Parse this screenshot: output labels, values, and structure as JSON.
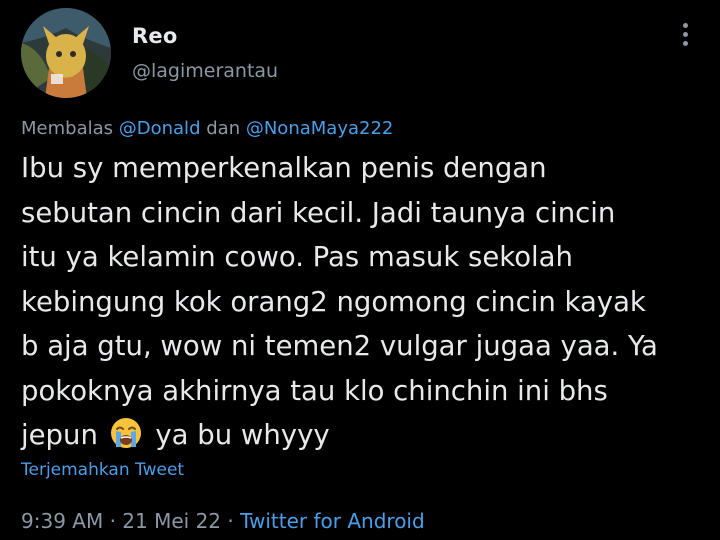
{
  "user": {
    "display_name": "Reo",
    "handle": "@lagimerantau",
    "avatar_icon": "avatar-image"
  },
  "menu": {
    "icon": "more-vertical-icon"
  },
  "reply": {
    "prefix": "Membalas",
    "mention_1": "@Donald",
    "conjunction": "dan",
    "mention_2": "@NonaMaya222"
  },
  "tweet": {
    "lines": [
      "Ibu sy memperkenalkan penis dengan",
      "sebutan cincin dari kecil. Jadi taunya cincin",
      "itu ya kelamin cowo. Pas masuk sekolah",
      "kebingung kok orang2 ngomong cincin kayak",
      "b aja gtu, wow ni temen2 vulgar jugaa yaa. Ya",
      "pokoknya akhirnya tau klo chinchin ini bhs"
    ],
    "last_line_before": "jepun",
    "emoji": "loudly-crying-face-icon",
    "last_line_after": "ya bu whyyy"
  },
  "translate_label": "Terjemahkan Tweet",
  "meta": {
    "time": "9:39 AM",
    "sep_1": "·",
    "date": "21 Mei 22",
    "sep_2": "·",
    "source": "Twitter for Android"
  },
  "colors": {
    "background": "#000000",
    "text": "#e7e9ea",
    "secondary": "#8b98a5",
    "link": "#4a9fe8"
  }
}
